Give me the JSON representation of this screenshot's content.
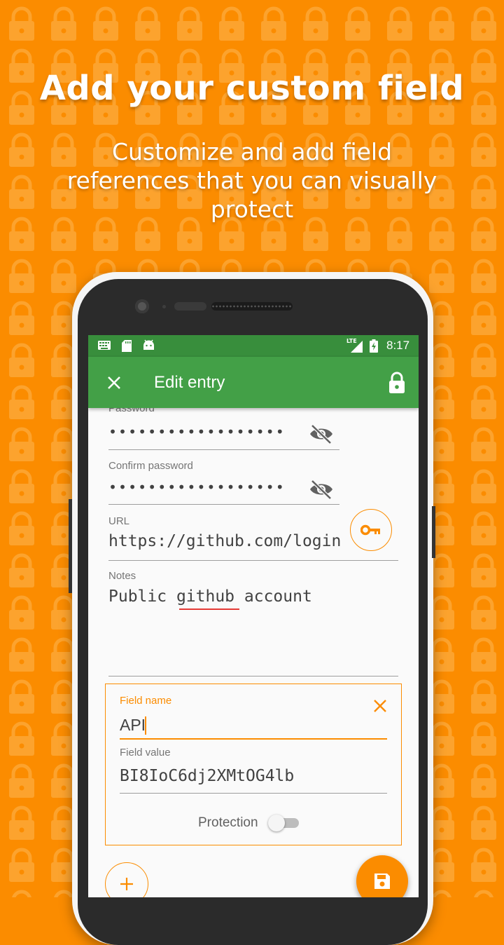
{
  "promo": {
    "title": "Add your custom field",
    "subtitle_lines": [
      "Customize and add field",
      "references that you can visually",
      "protect"
    ]
  },
  "status_bar": {
    "time": "8:17",
    "network": "LTE",
    "left_icons": [
      "keyboard-icon",
      "sd-card-icon",
      "android-icon"
    ]
  },
  "app_bar": {
    "title": "Edit entry",
    "close_icon": "close-icon",
    "action_icon": "lock-icon"
  },
  "form": {
    "password": {
      "label": "Password",
      "value": "••••••••••••••••••"
    },
    "confirm_password": {
      "label": "Confirm password",
      "value": "••••••••••••••••••"
    },
    "url": {
      "label": "URL",
      "value": "https://github.com/login"
    },
    "notes": {
      "label": "Notes",
      "value_before": "Public ",
      "value_misspelled": "github",
      "value_after": " account"
    }
  },
  "custom_field": {
    "name_label": "Field name",
    "name_value": "API",
    "value_label": "Field value",
    "value": "BI8IoC6dj2XMtOG4lb",
    "protection_label": "Protection",
    "protection_enabled": false
  },
  "colors": {
    "accent": "#fb8c00",
    "primary": "#43a047",
    "primary_dark": "#388e3c"
  }
}
